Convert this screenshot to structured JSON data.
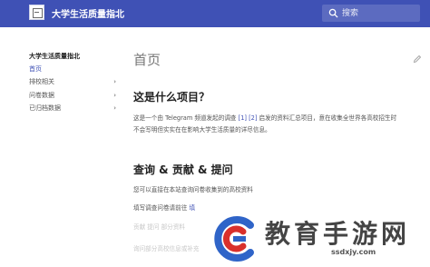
{
  "header": {
    "title": "大学生活质量指北",
    "search_placeholder": "搜索"
  },
  "sidebar": {
    "title": "大学生活质量指北",
    "items": [
      {
        "label": "首页",
        "active": true
      },
      {
        "label": "排校相关",
        "has_children": true
      },
      {
        "label": "问卷数据",
        "has_children": true
      },
      {
        "label": "已归档数据",
        "has_children": true
      }
    ]
  },
  "main": {
    "page_title": "首页",
    "section1": {
      "title": "这是什么项目？",
      "line1_prefix": "这是一个由 Telegram 频道发起的调查 ",
      "ref1": "[1]",
      "ref2": "[2]",
      "line1_suffix": " 启发的资料汇总项目，意在收集全世界各高校招生时",
      "line2": "不会写明但实实在在影响大学生活质量的详尽信息。"
    },
    "section2": {
      "title": "查询 & 贡献 & 提问",
      "line1": "您可以直接在本站查询问卷收集到的高校资料",
      "line2_prefix": "填写调查问卷请前往 ",
      "line2_link": "填",
      "line3": "贡献   提问   部分资料",
      "line4": "询问部分高校信息或补充"
    }
  },
  "watermark": {
    "text": "教育手游网",
    "url": "ssdxjy.com"
  },
  "colors": {
    "header_bg": "#3f51b5",
    "search_bg": "#5c6bc0",
    "link": "#3f51b5",
    "watermark_blue": "#2f64c8",
    "watermark_red": "#d9302c"
  },
  "icons": [
    "site-logo-icon",
    "search-icon",
    "chevron-right-icon",
    "edit-icon",
    "watermark-logo-icon"
  ]
}
